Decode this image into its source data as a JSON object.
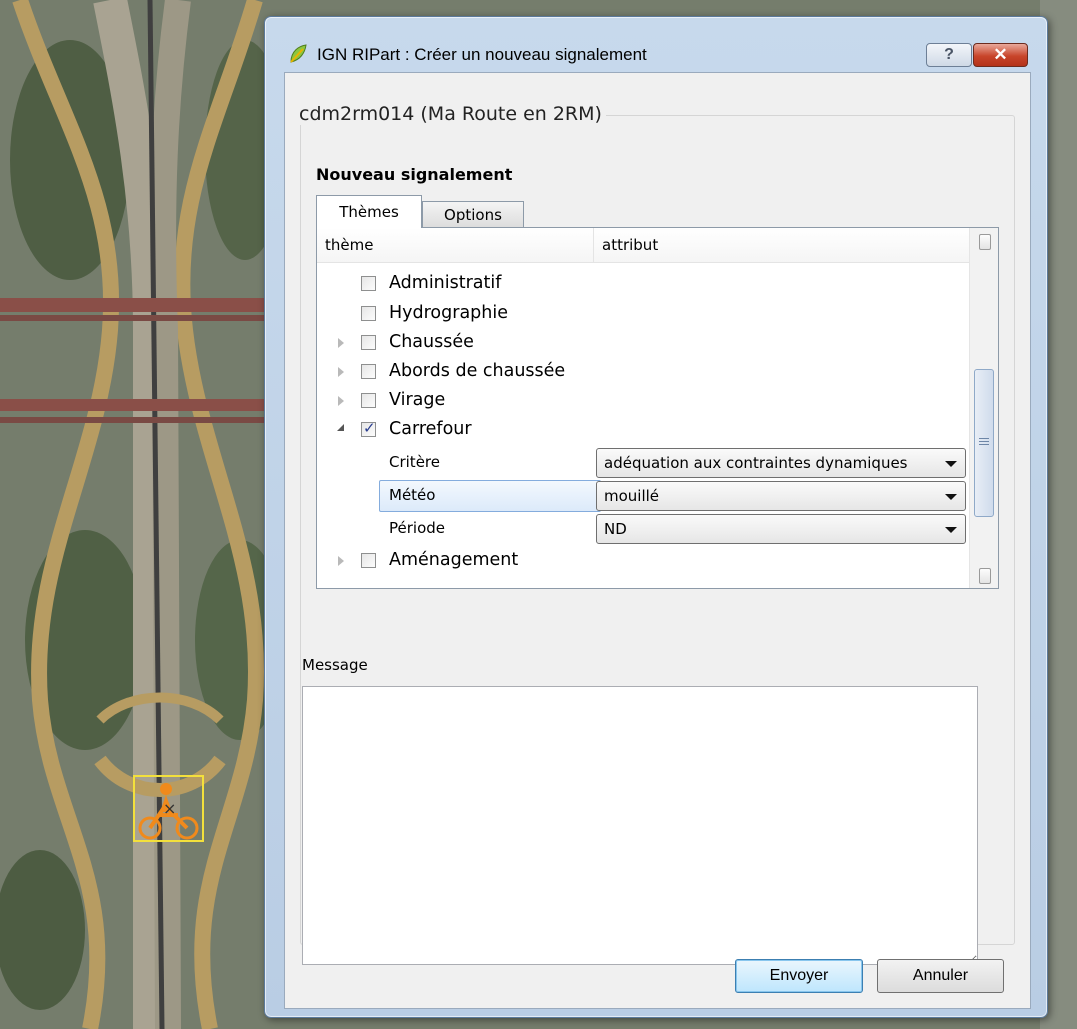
{
  "window": {
    "title": "IGN RIPart : Créer un nouveau signalement",
    "help_button": "?",
    "close_button": "✕"
  },
  "group": {
    "title": "cdm2rm014 (Ma Route en 2RM)"
  },
  "section_title": "Nouveau signalement",
  "tabs": [
    {
      "label": "Thèmes",
      "active": true
    },
    {
      "label": "Options",
      "active": false
    }
  ],
  "tree": {
    "columns": [
      "thème",
      "attribut"
    ],
    "items": [
      {
        "label": "Administratif",
        "expandable": false,
        "checked": false
      },
      {
        "label": "Hydrographie",
        "expandable": false,
        "checked": false
      },
      {
        "label": "Chaussée",
        "expandable": true,
        "checked": false
      },
      {
        "label": "Abords de chaussée",
        "expandable": true,
        "checked": false
      },
      {
        "label": "Virage",
        "expandable": true,
        "checked": false
      },
      {
        "label": "Carrefour",
        "expandable": true,
        "expanded": true,
        "checked": true
      },
      {
        "label": "Aménagement",
        "expandable": true,
        "checked": false
      }
    ],
    "attributes": [
      {
        "name": "Critère",
        "value": "adéquation aux contraintes dynamiques"
      },
      {
        "name": "Météo",
        "value": "mouillé",
        "selected": true
      },
      {
        "name": "Période",
        "value": "ND"
      }
    ]
  },
  "message": {
    "label": "Message",
    "value": ""
  },
  "buttons": {
    "send": "Envoyer",
    "cancel": "Annuler"
  },
  "colors": {
    "dialog_frame": "#c2d5ea",
    "close_button": "#c8452b",
    "map_marker": "#f08a1c",
    "selection": "#dceafa"
  },
  "map": {
    "marker_icon": "motorcycle-icon"
  }
}
